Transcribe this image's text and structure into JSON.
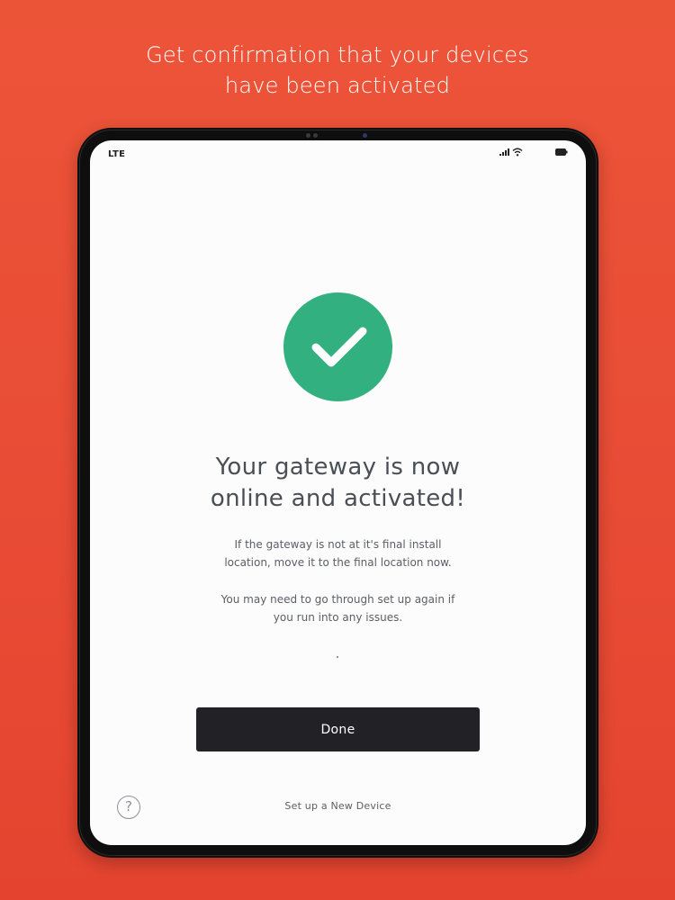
{
  "marketing": {
    "headline_line1": "Get confirmation that  your devices",
    "headline_line2": "have been activated"
  },
  "status_bar": {
    "carrier": "LTE",
    "icons": [
      "signal-icon",
      "wifi-icon",
      "battery-icon"
    ]
  },
  "confirmation": {
    "icon": "checkmark-icon",
    "title_line1": "Your gateway is now",
    "title_line2": "online and activated!",
    "message1_line1": "If the gateway is not at it's final install",
    "message1_line2": "location, move it to the final location now.",
    "message2_line1": "You may need to go through set up again if",
    "message2_line2": "you run into any issues.",
    "done_label": "Done",
    "help_symbol": "?",
    "new_device_label": "Set up a New Device"
  },
  "colors": {
    "background": "#e84b35",
    "success": "#33b07f",
    "button": "#222226",
    "screen": "#fcfcfc"
  }
}
